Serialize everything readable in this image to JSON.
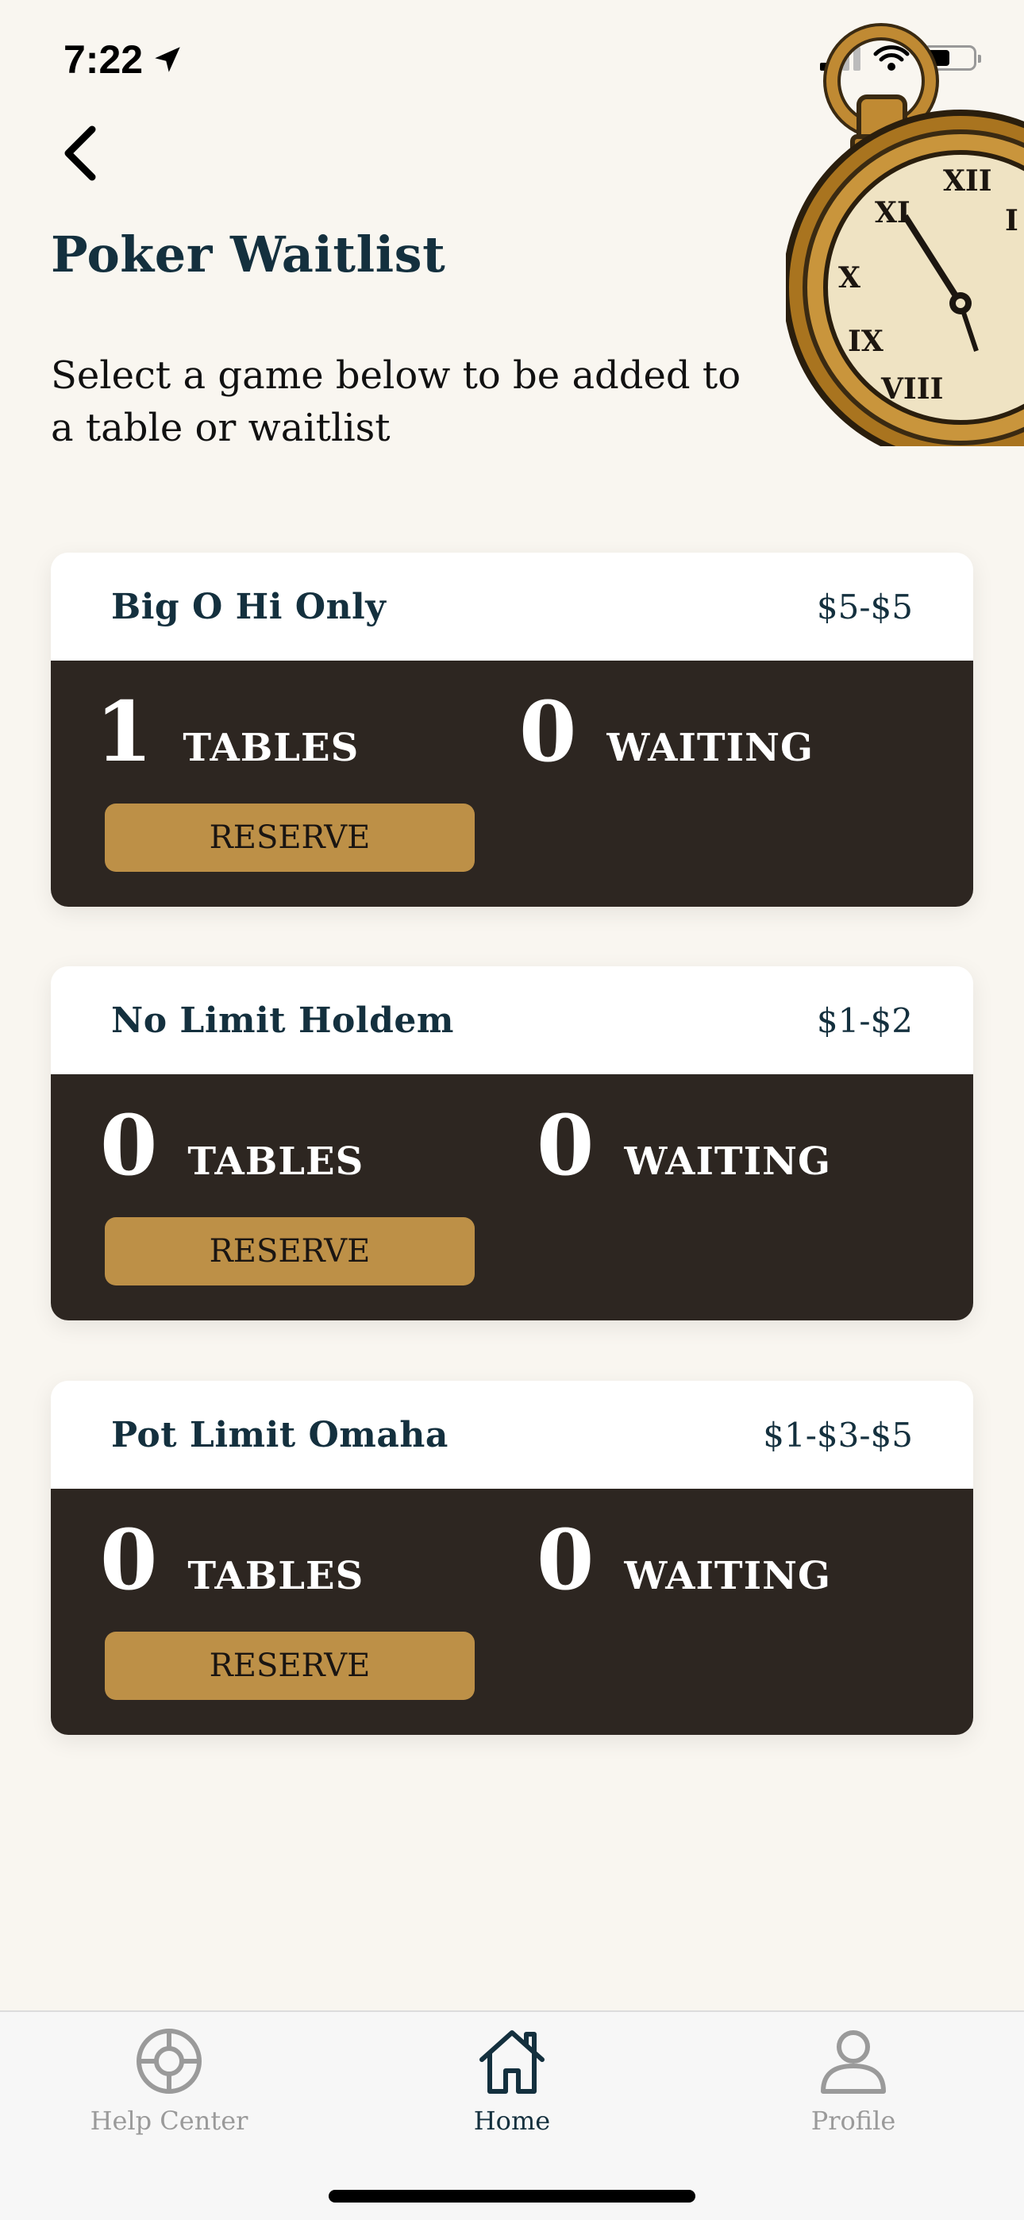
{
  "status_bar": {
    "time": "7:22",
    "location_icon": "location-arrow-icon",
    "wifi_icon": "wifi-icon",
    "battery_icon": "battery-icon",
    "battery_level": 0.5
  },
  "header": {
    "back_icon": "chevron-left-icon",
    "title": "Poker Waitlist",
    "subtitle": "Select a game below to be added to a table or waitlist",
    "illustration": "pocket-watch-icon"
  },
  "games": [
    {
      "name": "Big O Hi Only",
      "stakes": "$5-$5",
      "tables": "1",
      "tables_label": "TABLES",
      "waiting": "0",
      "waiting_label": "WAITING",
      "button_label": "RESERVE"
    },
    {
      "name": "No Limit Holdem",
      "stakes": "$1-$2",
      "tables": "0",
      "tables_label": "TABLES",
      "waiting": "0",
      "waiting_label": "WAITING",
      "button_label": "RESERVE"
    },
    {
      "name": "Pot Limit Omaha",
      "stakes": "$1-$3-$5",
      "tables": "0",
      "tables_label": "TABLES",
      "waiting": "0",
      "waiting_label": "WAITING",
      "button_label": "RESERVE"
    }
  ],
  "tabbar": {
    "items": [
      {
        "label": "Help Center",
        "icon": "lifebuoy-icon",
        "active": false
      },
      {
        "label": "Home",
        "icon": "home-icon",
        "active": true
      },
      {
        "label": "Profile",
        "icon": "user-icon",
        "active": false
      }
    ]
  },
  "colors": {
    "background": "#f9f6f0",
    "title": "#14303e",
    "card_dark": "#2d2621",
    "button_gold": "#bd9047",
    "tab_inactive": "#9a9a9a"
  }
}
